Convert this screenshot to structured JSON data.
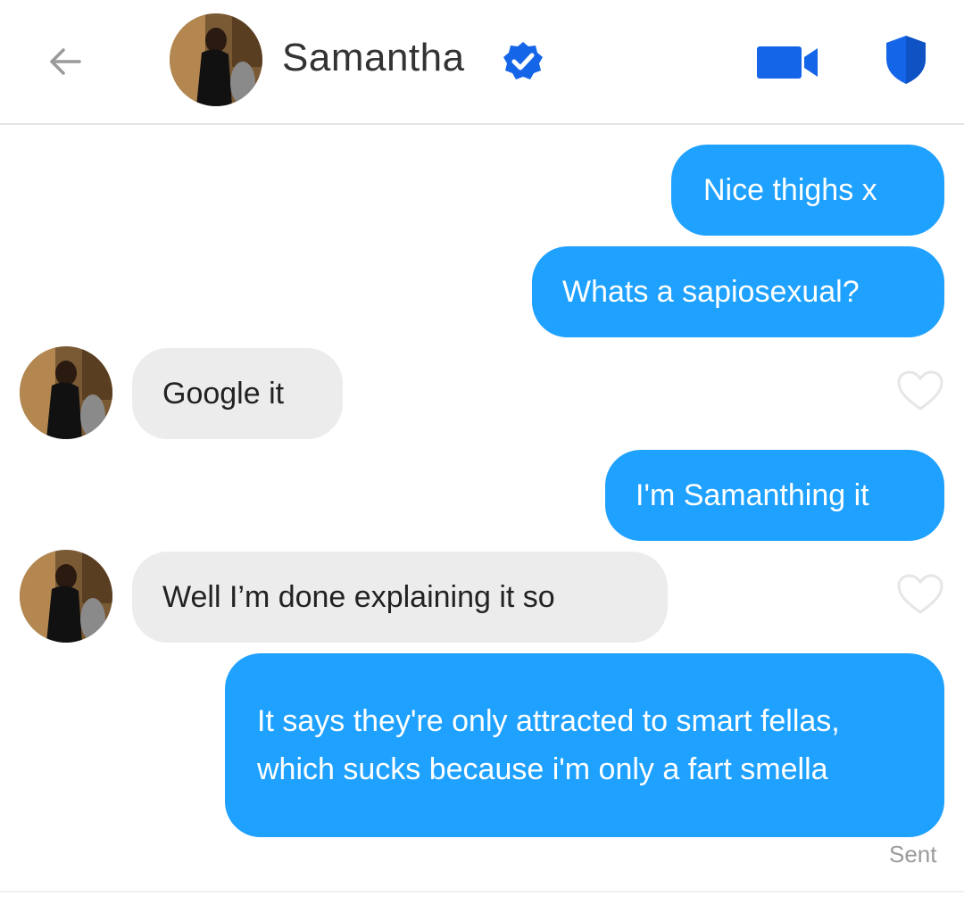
{
  "header": {
    "back_icon": "arrow-left-icon",
    "contact_name": "Samantha",
    "verified_icon": "verified-badge-icon",
    "video_icon": "video-camera-icon",
    "shield_icon": "shield-icon"
  },
  "colors": {
    "accent": "#1fa1ff",
    "incoming_bubble": "#ececec",
    "icon_blue": "#1565e8"
  },
  "messages": [
    {
      "direction": "out",
      "text": "Nice thighs x"
    },
    {
      "direction": "out",
      "text": "Whats a sapiosexual?"
    },
    {
      "direction": "in",
      "text": "Google it"
    },
    {
      "direction": "out",
      "text": "I'm Samanthing it"
    },
    {
      "direction": "in",
      "text": "Well I’m done explaining it so"
    },
    {
      "direction": "out",
      "text": "It says they're only attracted to smart fellas, which sucks because i'm only a fart smella"
    }
  ],
  "status": {
    "sent": "Sent"
  }
}
